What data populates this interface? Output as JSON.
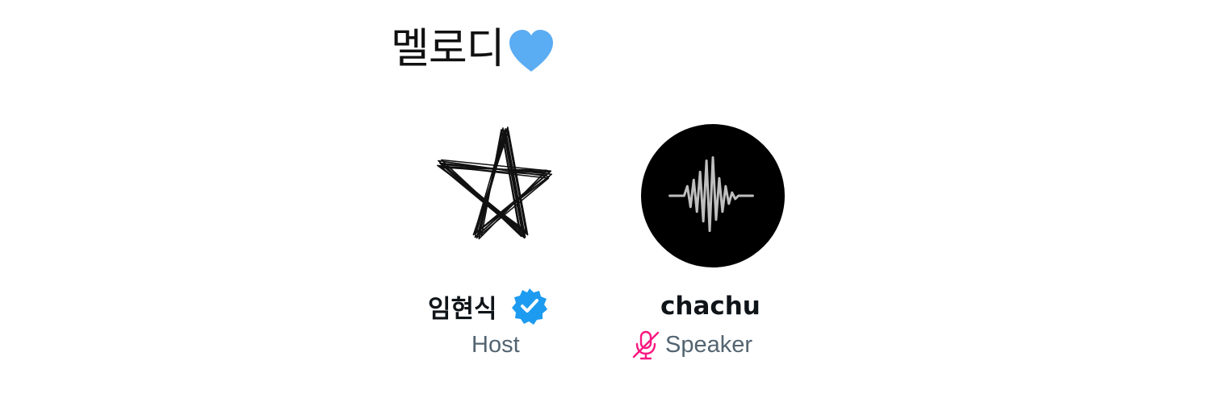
{
  "space": {
    "title": "멜로디",
    "title_icon": "blue-heart-icon"
  },
  "participants": [
    {
      "name": "임현식",
      "role": "Host",
      "verified": true,
      "avatar_icon": "scribbled-star-icon",
      "badge_color": "#1d9bf0"
    },
    {
      "name": "chachu",
      "role": "Speaker",
      "muted": true,
      "avatar_icon": "sound-wave-icon",
      "mic_icon": "mic-off-icon",
      "mic_color": "#f91880"
    }
  ],
  "colors": {
    "heart": "#5aacf3",
    "name_text": "#0f1419",
    "role_text": "#536471",
    "avatar_bg": "#000000",
    "wave": "#bfbfbf"
  }
}
